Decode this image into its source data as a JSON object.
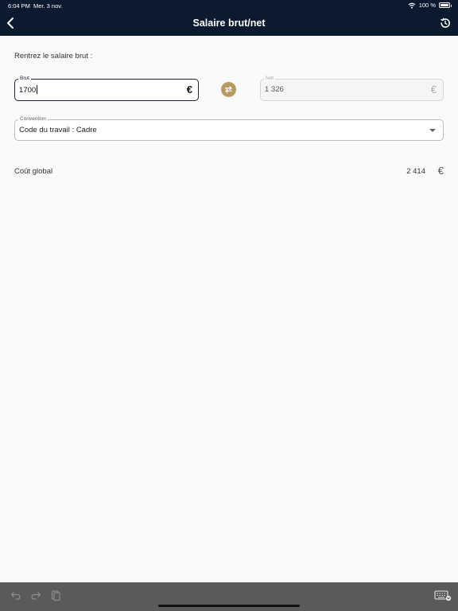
{
  "status_bar": {
    "time": "6:04 PM",
    "date": "Mer. 3 nov.",
    "battery": "100 %"
  },
  "nav": {
    "title": "Salaire brut/net",
    "back_icon": "chevron-left-icon",
    "history_icon": "history-icon"
  },
  "form": {
    "prompt": "Rentrez le salaire brut :",
    "brut": {
      "label": "Brut",
      "value": "1700",
      "currency": "€"
    },
    "net": {
      "label": "Net",
      "value": "1 326",
      "currency": "€"
    },
    "convention": {
      "label": "Convention",
      "value": "Code du travail : Cadre"
    }
  },
  "result": {
    "label": "Coût global",
    "value": "2 414",
    "currency": "€"
  },
  "colors": {
    "nav_bg": "#0b1a2e",
    "accent_gold": "#b99a63",
    "keyboard_bar": "#5a5a5a"
  }
}
